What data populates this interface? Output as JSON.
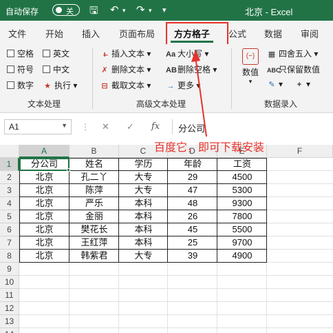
{
  "titlebar": {
    "autosave_label": "自动保存",
    "toggle_label": "关",
    "doc_title": "北京  -  Excel"
  },
  "tabs": [
    "文件",
    "开始",
    "插入",
    "页面布局",
    "方方格子",
    "公式",
    "数据",
    "审阅"
  ],
  "active_tab": "方方格子",
  "ribbon": {
    "text_group": {
      "items": [
        "空格",
        "英文",
        "符号",
        "中文",
        "数字"
      ],
      "execute": "执行",
      "label": "文本处理"
    },
    "advanced_group": {
      "insert_text": "插入文本",
      "delete_text": "删除文本",
      "extract_text": "截取文本",
      "case": "大小写",
      "delete_space": "删除空格",
      "more": "更多",
      "label": "高级文本处理"
    },
    "data_group": {
      "value_btn": "数值",
      "round": "四舍五入",
      "keep_value": "只保留数值",
      "label": "数据录入"
    }
  },
  "formula_bar": {
    "name_box": "A1",
    "formula": "分公司"
  },
  "sheet": {
    "columns": [
      "A",
      "B",
      "C",
      "D",
      "E",
      "F"
    ],
    "rows": [
      "1",
      "2",
      "3",
      "4",
      "5",
      "6",
      "7",
      "8",
      "9",
      "10",
      "11",
      "12",
      "13",
      "14"
    ],
    "header": [
      "分公司",
      "姓名",
      "学历",
      "年龄",
      "工资"
    ],
    "data": [
      [
        "北京",
        "孔二丫",
        "大专",
        "29",
        "4500"
      ],
      [
        "北京",
        "陈萍",
        "大专",
        "47",
        "5300"
      ],
      [
        "北京",
        "严乐",
        "本科",
        "48",
        "9300"
      ],
      [
        "北京",
        "金丽",
        "本科",
        "26",
        "7800"
      ],
      [
        "北京",
        "樊花长",
        "本科",
        "45",
        "5500"
      ],
      [
        "北京",
        "王红萍",
        "本科",
        "25",
        "9700"
      ],
      [
        "北京",
        "韩紫君",
        "大专",
        "39",
        "4900"
      ]
    ]
  },
  "annotation": "百度它，即可下载安装",
  "colors": {
    "excel_green": "#217346",
    "annotation_red": "#e8312b"
  }
}
